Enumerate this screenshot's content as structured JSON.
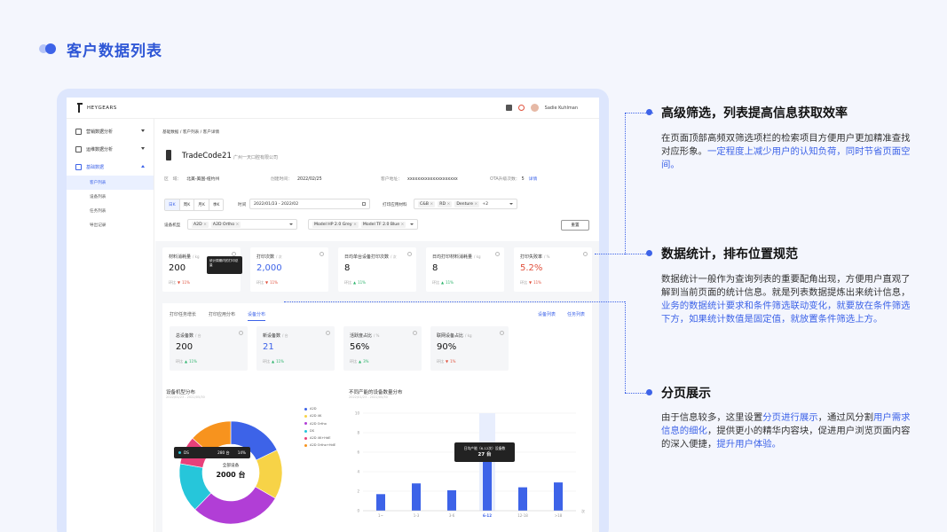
{
  "page": {
    "title": "客户数据列表"
  },
  "app": {
    "logo_text": "HEYGEARS",
    "user_name": "Sadie Kuhlman"
  },
  "sidebar": {
    "items": [
      {
        "label": "营销数据分析"
      },
      {
        "label": "运维数据分析"
      },
      {
        "label": "基础数据"
      }
    ],
    "subitems": [
      {
        "label": "客户列表"
      },
      {
        "label": "设备列表"
      },
      {
        "label": "任务列表"
      },
      {
        "label": "导出记录"
      }
    ]
  },
  "detail": {
    "breadcrumb": "基础数据 / 客户列表 / 客户详情",
    "name": "TradeCode21",
    "company": "广州一天口腔有限公司",
    "region_label": "区　域：",
    "region_value": "北美-美国-纽约州",
    "created_label": "创建时间：",
    "created_value": "2022/02/25",
    "address_label": "客户地址：",
    "address_value": "xxxxxxxxxxxxxxxxxxxx",
    "ota_label": "OTA升级次数：",
    "ota_value": "5",
    "ota_link": "详情"
  },
  "filters": {
    "time_tabs": [
      "日K",
      "周K",
      "月K",
      "季K"
    ],
    "time_label": "时间",
    "time_range": "2022/01/23 - 2022/02",
    "material_label": "打印应用材料",
    "material_chips": [
      "C&B",
      "RD",
      "Denture"
    ],
    "material_more": "+2",
    "model_label": "设备机型",
    "model_chips_left": [
      "A2D",
      "A2D Ortho"
    ],
    "model_chips_right": [
      "Model HP 2.0 Grey",
      "Model TF 2.0 Blue"
    ],
    "reset_label": "重置"
  },
  "stats": [
    {
      "title": "材料消耗量",
      "unit": "/ kg",
      "value": "200",
      "compare": "环比",
      "dir": "down",
      "pct": "11%",
      "color": "normal"
    },
    {
      "title": "打印次数",
      "unit": "/ 次",
      "value": "2,000",
      "compare": "环比",
      "dir": "down",
      "pct": "11%",
      "color": "blue"
    },
    {
      "title": "日均单台设备打印次数",
      "unit": "/ 次",
      "value": "8",
      "compare": "环比",
      "dir": "up",
      "pct": "11%",
      "color": "normal"
    },
    {
      "title": "日均打印材料消耗量",
      "unit": "/ kg",
      "value": "8",
      "compare": "环比",
      "dir": "up",
      "pct": "11%",
      "color": "normal"
    },
    {
      "title": "打印失败率",
      "unit": "/ %",
      "value": "5.2%",
      "compare": "环比",
      "dir": "down",
      "pct": "11%",
      "color": "red"
    }
  ],
  "tooltip_small": "统计周期内的打印总量",
  "panel": {
    "tabs": [
      "打印任务增长",
      "打印应用分布",
      "设备分布"
    ],
    "active_tab": 2,
    "links": [
      "设备列表",
      "任务列表"
    ]
  },
  "stats2": [
    {
      "title": "总设备数",
      "unit": "/ 台",
      "value": "200",
      "compare": "环比",
      "dir": "up",
      "pct": "11%",
      "color": "normal"
    },
    {
      "title": "新设备数",
      "unit": "/ 台",
      "value": "21",
      "compare": "环比",
      "dir": "up",
      "pct": "11%",
      "color": "blue"
    },
    {
      "title": "活跃度占比",
      "unit": "/ %",
      "value": "56%",
      "compare": "环比",
      "dir": "up",
      "pct": "3%",
      "color": "normal"
    },
    {
      "title": "联网设备占比",
      "unit": "/ kg",
      "value": "90%",
      "compare": "环比",
      "dir": "down",
      "pct": "1%",
      "color": "normal"
    }
  ],
  "chart_data": [
    {
      "type": "pie",
      "title": "设备机型分布",
      "subtitle": "2022/01/23 - 2022/05/30",
      "center_label": "全部设备",
      "center_value": "2000 台",
      "categories": [
        "A2D",
        "A2D 4K",
        "A2D Ortho",
        "DS",
        "A2D 4K+HdE",
        "A2D Ortho+HdE"
      ],
      "values": [
        16,
        14,
        26,
        14,
        8,
        12
      ],
      "colors": [
        "#3d63e8",
        "#f7d347",
        "#b13ed6",
        "#26c6da",
        "#e8407a",
        "#f7931e"
      ],
      "tooltip": {
        "name": "DS",
        "value": "280 台",
        "pct": "14%"
      }
    },
    {
      "type": "bar",
      "title": "不同产能的设备数量分布",
      "subtitle": "2022/01/23 - 2022/05/30",
      "categories": [
        "1~",
        "1-3",
        "3-6",
        "6-12",
        "12-18",
        ">18"
      ],
      "values": [
        1.7,
        2.8,
        2.1,
        5.1,
        2.4,
        2.9
      ],
      "ylim": [
        0,
        10
      ],
      "yticks": [
        0,
        2,
        4,
        6,
        8,
        10
      ],
      "xunit": "次",
      "highlight": 3,
      "tooltip": {
        "title": "日均产能（6-12次）设备数",
        "value": "27 台"
      }
    }
  ],
  "right": [
    {
      "heading": "高级筛选，列表提高信息获取效率",
      "text_plain": "在页面顶部高频双筛选项栏的检索项目方便用户更加精准查找对应形象。",
      "text_blue": "一定程度上减少用户的认知负荷，同时节省页面空间。"
    },
    {
      "heading": "数据统计，排布位置规范",
      "text_plain": "数据统计一般作为查询列表的重要配角出现，方便用户直观了解到当前页面的统计信息。就是列表数据提炼出来统计信息，",
      "text_blue": "业务的数据统计要求和条件筛选联动变化，就要放在条件筛选下方，如果统计数值是固定值，就放置条件筛选上方。"
    },
    {
      "heading": "分页展示",
      "t1": "由于信息较多，这里设置",
      "b1": "分页进行展示",
      "t2": "，通过风分割",
      "b2": "用户需求信息的细化",
      "t3": "，提供更小的精华内容块，促进用户浏览页面内容的深入便捷，",
      "b3": "提升用户体验。"
    }
  ]
}
